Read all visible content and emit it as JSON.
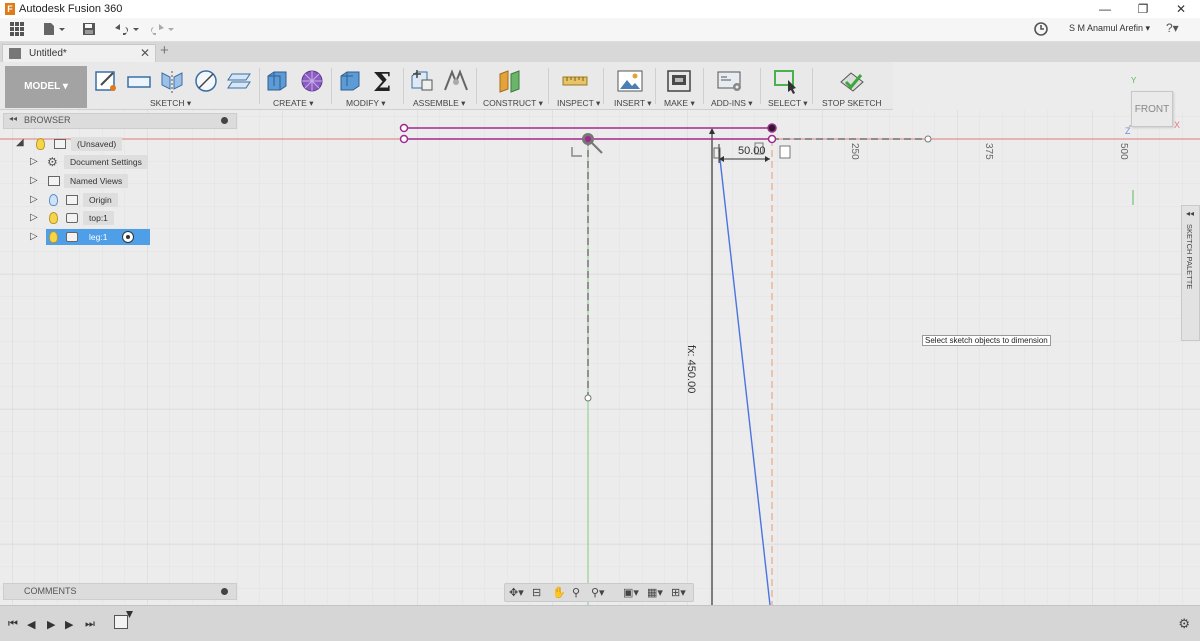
{
  "window": {
    "title": "Autodesk Fusion 360",
    "controls": {
      "minimize": "—",
      "maximize": "❐",
      "close": "✕"
    }
  },
  "appbar": {
    "user_name": "S M Anamul Arefin ▾",
    "help": "?▾"
  },
  "tab": {
    "label": "Untitled*",
    "close": "✕",
    "add": "+"
  },
  "ribbon": {
    "workspace": "MODEL ▾",
    "groups": {
      "sketch": "SKETCH ▾",
      "create": "CREATE ▾",
      "modify": "MODIFY ▾",
      "assemble": "ASSEMBLE ▾",
      "construct": "CONSTRUCT ▾",
      "inspect": "INSPECT ▾",
      "insert": "INSERT ▾",
      "make": "MAKE ▾",
      "addins": "ADD-INS ▾",
      "select": "SELECT ▾",
      "stop_sketch": "STOP SKETCH"
    }
  },
  "browser": {
    "title": "BROWSER",
    "items": [
      {
        "label": "(Unsaved)"
      },
      {
        "label": "Document Settings"
      },
      {
        "label": "Named Views"
      },
      {
        "label": "Origin"
      },
      {
        "label": "top:1"
      },
      {
        "label": "leg:1"
      }
    ]
  },
  "comments": {
    "title": "COMMENTS"
  },
  "viewport": {
    "dimension_horizontal": "50.00",
    "dimension_vertical": "fx: 450.00",
    "ruler_ticks": [
      "250",
      "375",
      "500"
    ],
    "tooltip": "Select sketch objects to dimension",
    "viewcube_face": "FRONT",
    "axis_labels": {
      "x": "X",
      "y": "Y",
      "z": "Z"
    }
  },
  "sketch_palette": {
    "label": "SKETCH PALETTE"
  },
  "colors": {
    "sketch_profile": "#a0288e",
    "sketch_line": "#3a6fe0",
    "red_axis": "#e06666",
    "green_axis": "#55b855",
    "dashed_orange": "#e8a87c"
  }
}
